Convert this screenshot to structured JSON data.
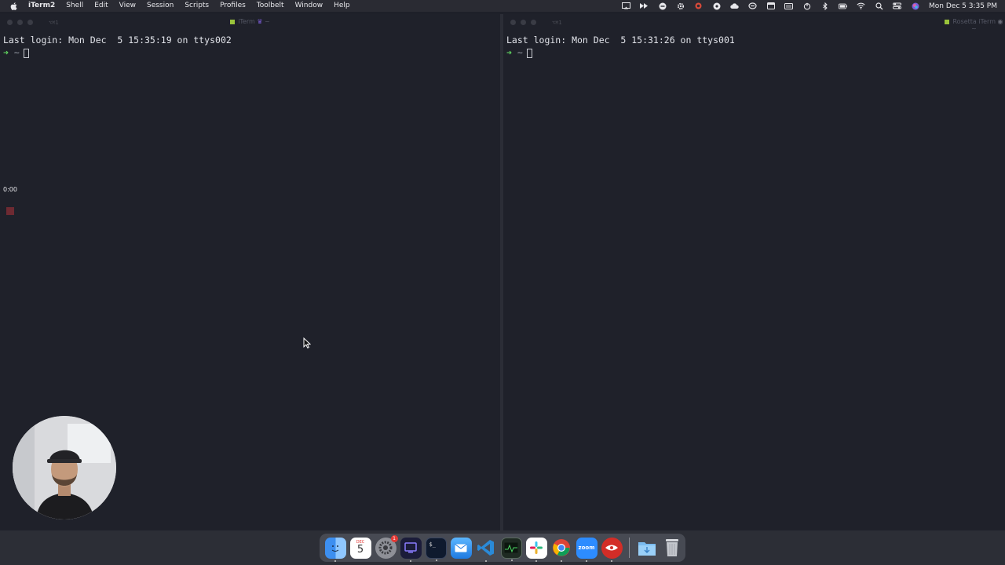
{
  "menubar": {
    "app_name": "iTerm2",
    "menus": [
      "Shell",
      "Edit",
      "View",
      "Session",
      "Scripts",
      "Profiles",
      "Toolbelt",
      "Window",
      "Help"
    ],
    "clock": "Mon Dec 5  3:35 PM"
  },
  "left_window": {
    "shortcut": "⌥⌘1",
    "title": "iTerm",
    "title_suffix": "~",
    "last_login": "Last login: Mon Dec  5 15:35:19 on ttys002",
    "prompt_dir": "~"
  },
  "right_window": {
    "shortcut": "⌥⌘1",
    "title": "Rosetta iTerm",
    "title_suffix": "~",
    "last_login": "Last login: Mon Dec  5 15:31:26 on ttys001",
    "prompt_dir": "~"
  },
  "recording": {
    "elapsed": "0:00"
  },
  "dock": {
    "calendar_month": "DEC",
    "calendar_day": "5",
    "settings_badge": "1",
    "zoom_label": "zoom"
  },
  "colors": {
    "terminal_bg": "#1f212a",
    "prompt_arrow": "#5fd35f",
    "recording_stop": "#6e2a32"
  }
}
